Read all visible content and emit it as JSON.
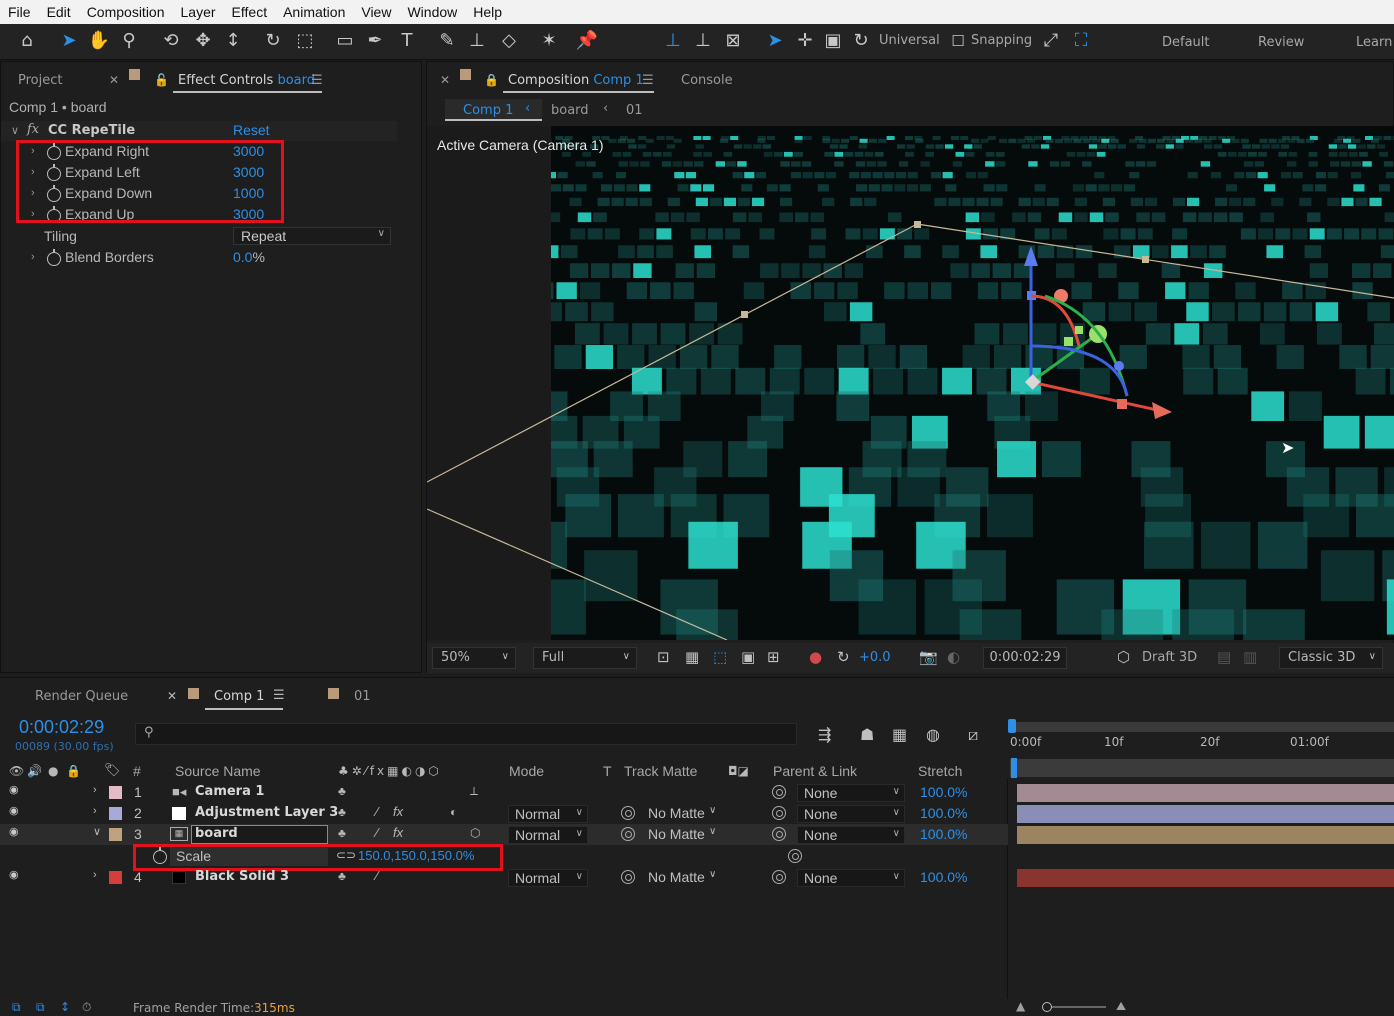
{
  "menu": [
    "File",
    "Edit",
    "Composition",
    "Layer",
    "Effect",
    "Animation",
    "View",
    "Window",
    "Help"
  ],
  "toolbar": {
    "axis_mode": "Universal",
    "snapping": "Snapping",
    "workspaces": [
      "Default",
      "Review",
      "Learn"
    ]
  },
  "left_panel": {
    "tabs": {
      "project": "Project",
      "effect_controls": "Effect Controls",
      "effect_controls_target": "board"
    },
    "breadcrumb": "Comp 1 • board",
    "effect": {
      "fx": "fx",
      "name": "CC RepeTile",
      "reset": "Reset"
    },
    "properties": [
      {
        "name": "Expand Right",
        "value": "3000"
      },
      {
        "name": "Expand Left",
        "value": "3000"
      },
      {
        "name": "Expand Down",
        "value": "1000"
      },
      {
        "name": "Expand Up",
        "value": "3000"
      }
    ],
    "tiling": {
      "label": "Tiling",
      "value": "Repeat"
    },
    "blend_borders": {
      "label": "Blend Borders",
      "value": "0.0",
      "unit": "%"
    }
  },
  "composition_panel": {
    "tab_label": "Composition",
    "tab_target": "Comp 1",
    "console": "Console",
    "breadcrumbs": [
      "Comp 1",
      "board",
      "01"
    ],
    "camera_label": "Active Camera (Camera 1)",
    "footer": {
      "zoom": "50%",
      "resolution": "Full",
      "exposure": "+0.0",
      "timecode": "0:00:02:29",
      "draft": "Draft 3D",
      "renderer": "Classic 3D"
    }
  },
  "timeline": {
    "tabs": {
      "render_queue": "Render Queue",
      "comp": "Comp 1",
      "other": "01"
    },
    "current_time": "0:00:02:29",
    "frame_info": "00089 (30.00 fps)",
    "search_placeholder": "",
    "columns": {
      "num": "#",
      "source_name": "Source Name",
      "mode": "Mode",
      "t": "T",
      "track_matte": "Track Matte",
      "parent": "Parent & Link",
      "stretch": "Stretch"
    },
    "ruler": [
      "0:00f",
      "10f",
      "20f",
      "01:00f"
    ],
    "layers": [
      {
        "num": "1",
        "name": "Camera 1",
        "label_color": "#e6b9c6",
        "mode": "",
        "matte": "",
        "parent": "None",
        "stretch": "100.0%",
        "bar_color": "#a48a92"
      },
      {
        "num": "2",
        "name": "Adjustment Layer 3",
        "label_color": "#a7a9d9",
        "mode": "Normal",
        "matte": "No Matte",
        "parent": "None",
        "stretch": "100.0%",
        "bar_color": "#8a8db6"
      },
      {
        "num": "3",
        "name": "board",
        "label_color": "#c2a27e",
        "mode": "Normal",
        "matte": "No Matte",
        "parent": "None",
        "stretch": "100.0%",
        "bar_color": "#9c8460"
      },
      {
        "num": "4",
        "name": "Black Solid 3",
        "label_color": "#d3403a",
        "mode": "Normal",
        "matte": "No Matte",
        "parent": "None",
        "stretch": "100.0%",
        "bar_color": "#8a3430"
      }
    ],
    "scale_property": {
      "name": "Scale",
      "value": "150.0,150.0,150.0%"
    }
  },
  "status": {
    "frame_render_label": "Frame Render Time:",
    "frame_render_value": "315ms"
  },
  "colors": {
    "accent": "#2e8fe6",
    "highlight": "#e0131c",
    "tile": "#2de0d0"
  }
}
